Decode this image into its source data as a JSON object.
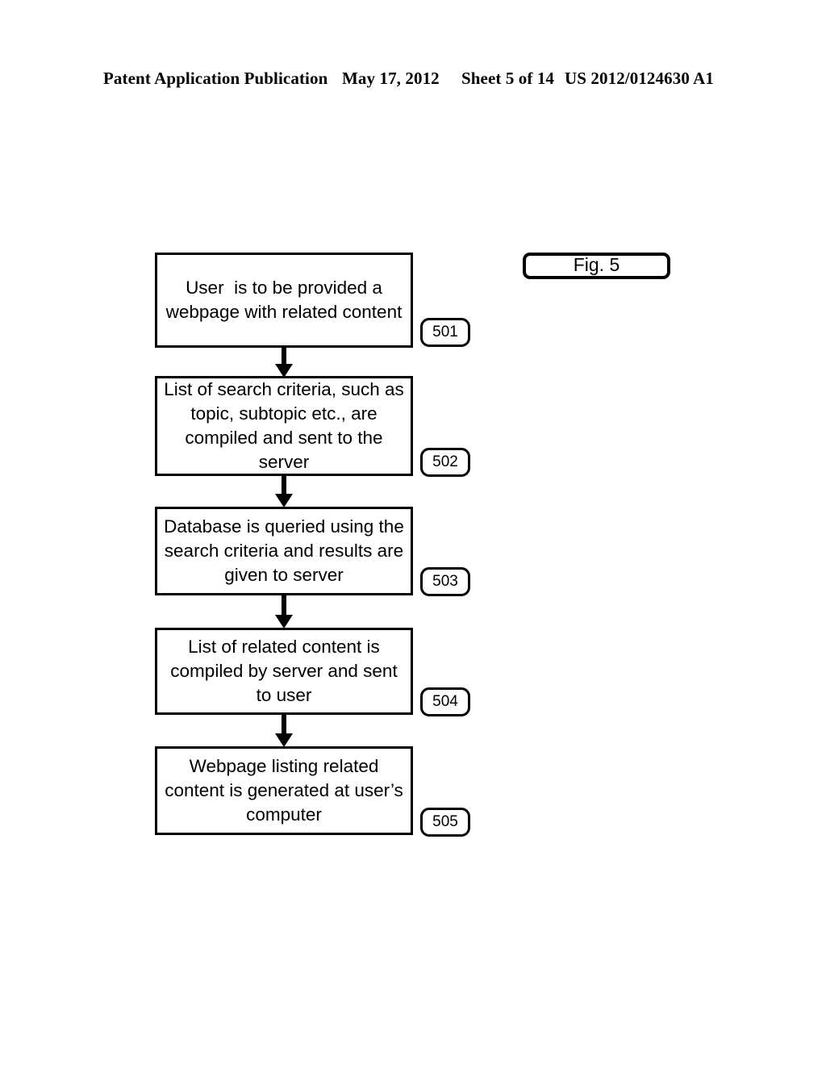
{
  "header": {
    "publication": "Patent Application Publication",
    "date": "May 17, 2012",
    "sheet": "Sheet 5 of 14",
    "publication_number": "US 2012/0124630 A1"
  },
  "figure": {
    "label": "Fig. 5"
  },
  "flowchart": {
    "steps": [
      {
        "ref": "501",
        "text": "User  is to be provided a webpage with related content"
      },
      {
        "ref": "502",
        "text": "List of search criteria, such as topic, subtopic etc., are compiled and sent to the server"
      },
      {
        "ref": "503",
        "text": "Database is queried using the search criteria and results are given to server"
      },
      {
        "ref": "504",
        "text": "List of related content is compiled by server and sent to user"
      },
      {
        "ref": "505",
        "text": "Webpage listing related content is generated at user’s computer"
      }
    ],
    "connector_count": 4,
    "colors": {
      "stroke": "#000000",
      "background": "#ffffff"
    }
  }
}
